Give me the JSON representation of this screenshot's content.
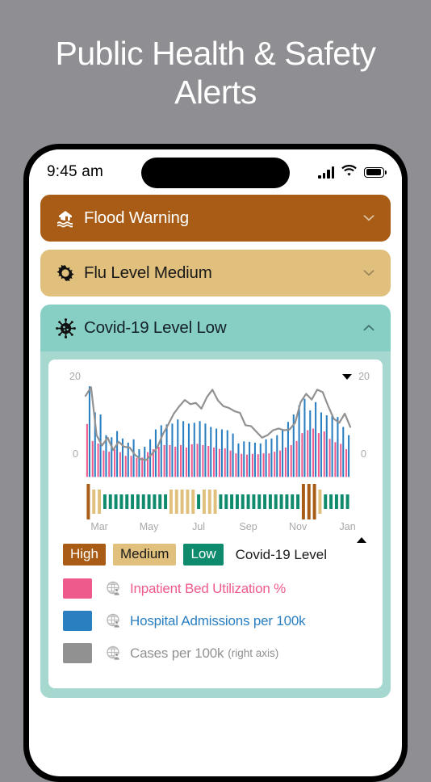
{
  "page": {
    "title": "Public Health & Safety Alerts"
  },
  "status_bar": {
    "time": "9:45 am",
    "signal_icon": "cellular-signal-icon",
    "wifi_icon": "wifi-icon",
    "battery_icon": "battery-icon"
  },
  "alerts": [
    {
      "id": "flood",
      "icon": "flood-house-icon",
      "label": "Flood Warning",
      "chevron": "chevron-down-icon",
      "expanded": false,
      "bg": "#a85c15",
      "fg": "#ffffff"
    },
    {
      "id": "flu",
      "icon": "virus-icon",
      "label": "Flu Level Medium",
      "chevron": "chevron-down-icon",
      "expanded": false,
      "bg": "#e0c07c",
      "fg": "#1a1a1a"
    },
    {
      "id": "covid",
      "icon": "coronavirus-icon",
      "label": "Covid-19 Level Low",
      "chevron": "chevron-up-icon",
      "expanded": true,
      "bg": "#87cfc4",
      "fg": "#14202a"
    }
  ],
  "legend": {
    "levels": [
      {
        "label": "High",
        "color": "#a85c15",
        "text_color": "#ffffff"
      },
      {
        "label": "Medium",
        "color": "#e0c07c",
        "text_color": "#1a1a1a"
      },
      {
        "label": "Low",
        "color": "#0e8a6c",
        "text_color": "#ffffff"
      }
    ],
    "levels_caption": "Covid-19 Level",
    "series": [
      {
        "label": "Inpatient Bed Utilization %",
        "sub": "",
        "color": "#ef5a8c",
        "text_color": "#ef5a8c",
        "icon": "globe-person-icon"
      },
      {
        "label": "Hospital Admissions per 100k",
        "sub": "",
        "color": "#2a7fc1",
        "text_color": "#2a7fc1",
        "icon": "globe-person-icon"
      },
      {
        "label": "Cases per 100k",
        "sub": "(right axis)",
        "color": "#919191",
        "text_color": "#919191",
        "icon": "globe-person-icon"
      }
    ]
  },
  "chart_data": {
    "type": "bar",
    "title": "",
    "xlabel": "",
    "ylabel": "",
    "ylim": [
      0,
      20
    ],
    "y2lim": [
      0,
      20
    ],
    "left_axis_top_label": "20",
    "left_axis_bottom_label": "0",
    "right_axis_top_label": "20",
    "right_axis_bottom_label": "0",
    "grid": false,
    "legend_position": "below",
    "scroll_up_marker": "triangle-up-icon",
    "scroll_down_marker": "triangle-down-icon",
    "month_ticks": [
      {
        "label": "Mar",
        "index": 2
      },
      {
        "label": "May",
        "index": 11
      },
      {
        "label": "Jul",
        "index": 20
      },
      {
        "label": "Sep",
        "index": 29
      },
      {
        "label": "Nov",
        "index": 38
      },
      {
        "label": "Jan",
        "index": 47
      }
    ],
    "series": [
      {
        "name": "Inpatient Bed Utilization %",
        "color": "#ef5a8c",
        "type": "bar",
        "axis": "left",
        "values": [
          8.7,
          4.6,
          4.0,
          2.3,
          2.0,
          2.6,
          1.9,
          1.0,
          1.0,
          0.5,
          0.6,
          1.9,
          2.6,
          3.2,
          3.6,
          3.6,
          3.2,
          3.6,
          3.0,
          3.8,
          3.9,
          3.6,
          3.4,
          3.0,
          2.7,
          2.8,
          2.3,
          1.6,
          1.5,
          1.3,
          1.5,
          1.4,
          1.6,
          1.6,
          2.0,
          2.3,
          3.0,
          3.6,
          4.6,
          6.5,
          7.2,
          7.6,
          6.5,
          6.9,
          5.1,
          4.3,
          3.9,
          2.6
        ]
      },
      {
        "name": "Hospital Admissions per 100k",
        "color": "#2a7fc1",
        "type": "bar",
        "axis": "left",
        "values": [
          17.8,
          11.5,
          11.0,
          6.0,
          5.5,
          7.0,
          5.2,
          4.2,
          5.0,
          2.6,
          3.2,
          5.0,
          7.4,
          8.4,
          8.6,
          8.8,
          9.8,
          9.4,
          8.8,
          9.0,
          9.4,
          8.8,
          8.0,
          7.6,
          7.4,
          7.2,
          6.4,
          4.0,
          4.5,
          4.4,
          4.2,
          4.0,
          5.0,
          5.2,
          6.0,
          7.4,
          9.2,
          11.0,
          13.2,
          14.8,
          12.0,
          14.0,
          11.5,
          10.8,
          11.0,
          10.4,
          8.0,
          6.0
        ]
      },
      {
        "name": "Cases per 100k",
        "color": "#919191",
        "type": "line",
        "axis": "right",
        "values": [
          15.5,
          17.6,
          6.0,
          3.5,
          5.4,
          2.4,
          4.4,
          3.2,
          3.0,
          1.2,
          0.2,
          0.0,
          1.4,
          3.0,
          6.2,
          8.6,
          11.2,
          13.0,
          14.5,
          13.5,
          13.8,
          12.4,
          15.2,
          17.0,
          14.4,
          13.0,
          12.6,
          11.8,
          11.4,
          8.4,
          8.2,
          6.8,
          5.4,
          6.0,
          7.2,
          7.6,
          7.2,
          7.4,
          9.0,
          14.0,
          16.0,
          14.6,
          17.0,
          16.4,
          13.0,
          10.0,
          9.0,
          11.2,
          8.0
        ]
      }
    ],
    "level_band": {
      "name": "Covid-19 Level",
      "colors": {
        "High": "#a85c15",
        "Medium": "#e0c07c",
        "Low": "#0e8a6c"
      },
      "values": [
        "High",
        "Medium",
        "Medium",
        "Low",
        "Low",
        "Low",
        "Low",
        "Low",
        "Low",
        "Low",
        "Low",
        "Low",
        "Low",
        "Low",
        "Low",
        "Medium",
        "Medium",
        "Medium",
        "Medium",
        "Medium",
        "Low",
        "Medium",
        "Medium",
        "Medium",
        "Low",
        "Low",
        "Low",
        "Low",
        "Low",
        "Low",
        "Low",
        "Low",
        "Low",
        "Low",
        "Low",
        "Low",
        "Low",
        "Low",
        "Low",
        "High",
        "High",
        "High",
        "Medium",
        "Low",
        "Low",
        "Low",
        "Low",
        "Low"
      ]
    }
  }
}
